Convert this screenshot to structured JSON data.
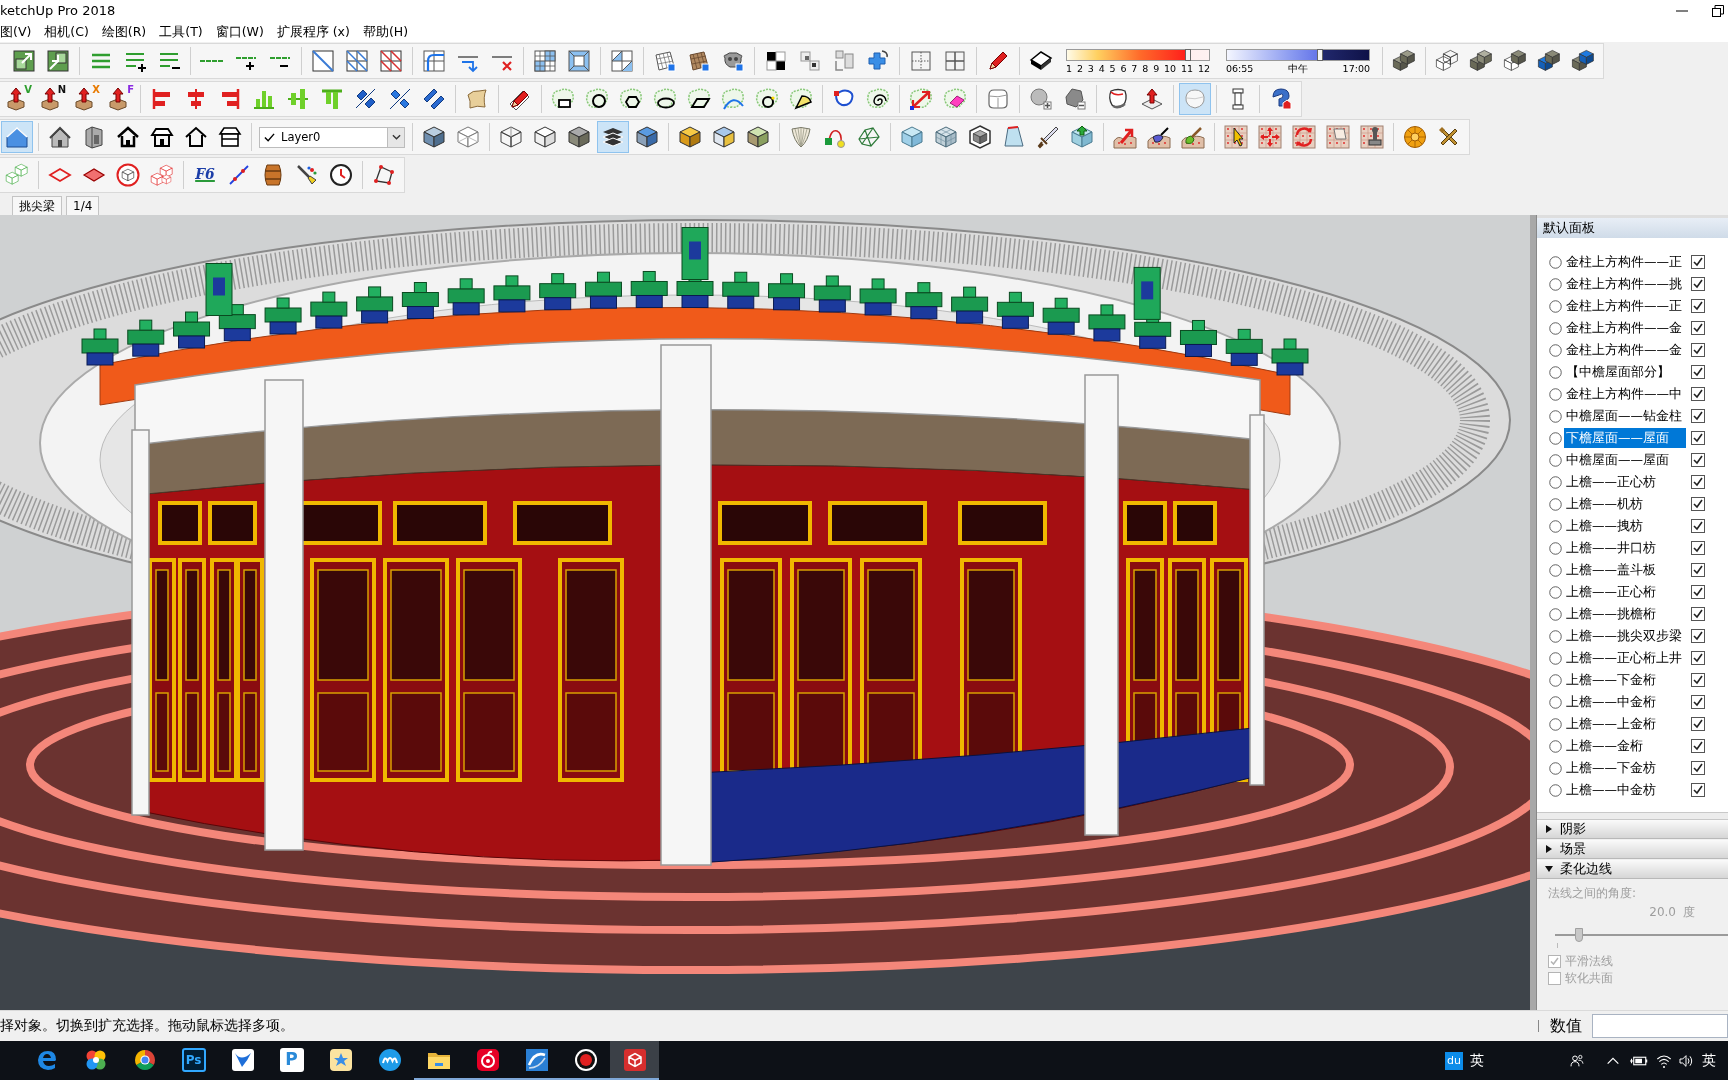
{
  "window": {
    "title": "ketchUp Pro 2018"
  },
  "menu": [
    "图(V)",
    "相机(C)",
    "绘图(R)",
    "工具(T)",
    "窗口(W)",
    "扩展程序 (x)",
    "帮助(H)"
  ],
  "toolbars": [
    [
      [
        {
          "kind": "square-out",
          "selected": false
        },
        {
          "kind": "square-in",
          "selected": false
        }
      ],
      [
        {
          "kind": "lines",
          "selected": false
        },
        {
          "kind": "lines-plus",
          "selected": false
        },
        {
          "kind": "lines-minus",
          "selected": false
        }
      ],
      [
        {
          "kind": "line",
          "selected": false
        },
        {
          "kind": "line-plus",
          "selected": false
        },
        {
          "kind": "line-minus",
          "selected": false
        }
      ],
      [
        {
          "kind": "diag-square",
          "selected": false
        },
        {
          "kind": "diag-grid",
          "selected": false
        },
        {
          "kind": "diag-grid-red",
          "selected": false
        }
      ],
      [
        {
          "kind": "grid-curve",
          "selected": false
        },
        {
          "kind": "line-arrow",
          "selected": false
        },
        {
          "kind": "line-x",
          "selected": false
        }
      ],
      [
        {
          "kind": "grid-blue",
          "selected": false
        },
        {
          "kind": "frame-blue",
          "selected": false
        }
      ],
      [
        {
          "kind": "grid-split",
          "selected": false
        }
      ],
      [
        {
          "kind": "mesh",
          "selected": false
        },
        {
          "kind": "mesh-tex",
          "selected": false
        },
        {
          "kind": "monkey",
          "selected": false
        }
      ],
      [
        {
          "kind": "checker",
          "selected": false
        },
        {
          "kind": "small-squares",
          "selected": false
        },
        {
          "kind": "uv-blocks",
          "selected": false
        },
        {
          "kind": "cross-arrow",
          "selected": false
        }
      ],
      [
        {
          "kind": "pane-dotted",
          "selected": false
        },
        {
          "kind": "pane-grid",
          "selected": false
        }
      ],
      [
        {
          "kind": "pencil",
          "selected": false
        }
      ],
      [
        {
          "kind": "eraser-cube",
          "selected": false
        },
        {
          "kind": "month-slider",
          "level": 0.86,
          "labels": [
            "1",
            "2",
            "3",
            "4",
            "5",
            "6",
            "7",
            "8",
            "9",
            "10",
            "11",
            "12"
          ]
        },
        {
          "kind": "time-slider",
          "level": 0.66,
          "labels": [
            "06:55",
            "中午",
            "17:00"
          ]
        }
      ],
      [
        {
          "kind": "boxes-stack",
          "selected": false
        }
      ],
      [
        {
          "kind": "boxes-wire",
          "selected": false
        },
        {
          "kind": "boxes-grey",
          "selected": false
        },
        {
          "kind": "boxes-mixed",
          "selected": false
        },
        {
          "kind": "boxes-blue",
          "selected": false
        },
        {
          "kind": "boxes-blue2",
          "selected": false
        }
      ]
    ],
    [
      [
        {
          "kind": "arrow-box",
          "label": "V",
          "color": "#2e9e2e",
          "selected": false
        },
        {
          "kind": "arrow-box",
          "label": "N",
          "color": "#111111",
          "selected": false
        },
        {
          "kind": "arrow-box",
          "label": "X",
          "color": "#e87a00",
          "selected": false
        },
        {
          "kind": "arrow-box",
          "label": "F",
          "color": "#8a2be2",
          "selected": false
        }
      ],
      [
        {
          "kind": "align-left",
          "selected": false
        },
        {
          "kind": "align-center",
          "selected": false
        },
        {
          "kind": "align-right",
          "selected": false
        },
        {
          "kind": "align-bottom",
          "selected": false
        },
        {
          "kind": "align-middle",
          "selected": false
        },
        {
          "kind": "align-top",
          "selected": false
        },
        {
          "kind": "distribute-a",
          "selected": false
        },
        {
          "kind": "distribute-b",
          "selected": false
        },
        {
          "kind": "distribute-c",
          "selected": false
        }
      ],
      [
        {
          "kind": "surface",
          "selected": false
        }
      ],
      [
        {
          "kind": "pencil-ruler",
          "selected": false
        }
      ],
      [
        {
          "kind": "cloud-rect",
          "selected": false
        },
        {
          "kind": "cloud-circle",
          "selected": false
        },
        {
          "kind": "cloud-hexagon",
          "selected": false
        },
        {
          "kind": "cloud-ellipse",
          "selected": false
        },
        {
          "kind": "cloud-parallelogram",
          "selected": false
        },
        {
          "kind": "cloud-arc",
          "selected": false
        },
        {
          "kind": "cloud-ring",
          "selected": false
        },
        {
          "kind": "cloud-pie",
          "selected": false
        }
      ],
      [
        {
          "kind": "outline-path",
          "selected": false
        },
        {
          "kind": "cloud-spiral",
          "selected": false
        }
      ],
      [
        {
          "kind": "cloud-arrow",
          "selected": false
        },
        {
          "kind": "cloud-eraser",
          "selected": false
        }
      ],
      [
        {
          "kind": "soft-cube",
          "selected": false
        }
      ],
      [
        {
          "kind": "sphere-plus",
          "selected": false
        },
        {
          "kind": "poly-minus",
          "selected": false
        }
      ],
      [
        {
          "kind": "rock",
          "selected": false
        },
        {
          "kind": "push-up",
          "selected": false
        }
      ],
      [
        {
          "kind": "soft-blob",
          "selected": true
        }
      ],
      [
        {
          "kind": "pillar",
          "selected": false
        }
      ],
      [
        {
          "kind": "hook",
          "selected": false
        }
      ]
    ],
    [
      [
        {
          "kind": "house-blue",
          "selected": true
        }
      ],
      [
        {
          "kind": "house-grey",
          "selected": false
        },
        {
          "kind": "box-door",
          "selected": false
        },
        {
          "kind": "house-black",
          "selected": false
        },
        {
          "kind": "house-roof",
          "selected": false
        },
        {
          "kind": "house-outline",
          "selected": false
        },
        {
          "kind": "house-box",
          "selected": false
        }
      ],
      [
        {
          "kind": "layer-select",
          "value": "Layer0"
        }
      ],
      [
        {
          "kind": "cube-blue",
          "selected": false
        },
        {
          "kind": "cube-wire",
          "selected": false
        }
      ],
      [
        {
          "kind": "box-wire",
          "selected": false
        },
        {
          "kind": "box-white",
          "selected": false
        },
        {
          "kind": "box-grey",
          "selected": false
        },
        {
          "kind": "layers-stack",
          "selected": true
        },
        {
          "kind": "box-blue",
          "selected": false
        }
      ],
      [
        {
          "kind": "cube-yellow",
          "selected": false
        },
        {
          "kind": "cube-tri",
          "selected": false
        },
        {
          "kind": "cube-green",
          "selected": false
        }
      ],
      [
        {
          "kind": "ribbed-shell",
          "selected": false
        },
        {
          "kind": "arc-nodes",
          "selected": false
        },
        {
          "kind": "wire-net",
          "selected": false
        }
      ],
      [
        {
          "kind": "cube-ice",
          "selected": false
        },
        {
          "kind": "cube-mesh",
          "selected": false
        },
        {
          "kind": "cube-outline",
          "selected": false
        },
        {
          "kind": "wedge",
          "selected": false
        },
        {
          "kind": "sword",
          "selected": false
        },
        {
          "kind": "box-arrow",
          "selected": false
        }
      ],
      [
        {
          "kind": "terrain-arrow",
          "selected": false
        },
        {
          "kind": "terrain-stamp",
          "selected": false
        },
        {
          "kind": "terrain-brush",
          "selected": false
        }
      ],
      [
        {
          "kind": "grid-cursor",
          "selected": false
        },
        {
          "kind": "grid-arrows",
          "selected": false
        },
        {
          "kind": "grid-rotate",
          "selected": false
        },
        {
          "kind": "grid-flip",
          "selected": false
        },
        {
          "kind": "grid-stamp",
          "selected": false
        }
      ],
      [
        {
          "kind": "compass",
          "selected": false
        },
        {
          "kind": "tools",
          "selected": false
        }
      ]
    ],
    [
      [
        {
          "kind": "cubes-green",
          "selected": false
        }
      ],
      [
        {
          "kind": "diamond-outline",
          "selected": false
        },
        {
          "kind": "diamond-red",
          "selected": false
        },
        {
          "kind": "cube-ring",
          "selected": false
        },
        {
          "kind": "cubes-red",
          "selected": false
        }
      ],
      [
        {
          "kind": "letter-logo",
          "label": "F6",
          "selected": false
        },
        {
          "kind": "line-dots",
          "selected": false
        },
        {
          "kind": "barrel",
          "selected": false
        },
        {
          "kind": "paint-wand",
          "selected": false
        },
        {
          "kind": "clock",
          "selected": false
        }
      ],
      [
        {
          "kind": "polygon-dots",
          "selected": false
        }
      ]
    ]
  ],
  "scene_tabs": [
    {
      "label": "挑尖梁",
      "selected": false
    },
    {
      "label": "1/4",
      "selected": false
    }
  ],
  "panel": {
    "title": "默认面板",
    "layers": [
      {
        "name": "金柱上方构件——正",
        "active": false,
        "visible": true,
        "selected": false
      },
      {
        "name": "金柱上方构件——挑",
        "active": false,
        "visible": true,
        "selected": false
      },
      {
        "name": "金柱上方构件——正",
        "active": false,
        "visible": true,
        "selected": false
      },
      {
        "name": "金柱上方构件——金",
        "active": false,
        "visible": true,
        "selected": false
      },
      {
        "name": "金柱上方构件——金",
        "active": false,
        "visible": true,
        "selected": false
      },
      {
        "name": "【中檐屋面部分】",
        "active": false,
        "visible": true,
        "selected": false
      },
      {
        "name": "金柱上方构件——中",
        "active": false,
        "visible": true,
        "selected": false
      },
      {
        "name": "中檐屋面——钻金柱",
        "active": false,
        "visible": true,
        "selected": false
      },
      {
        "name": "下檐屋面——屋面",
        "active": false,
        "visible": true,
        "selected": true
      },
      {
        "name": "中檐屋面——屋面",
        "active": false,
        "visible": true,
        "selected": false
      },
      {
        "name": "上檐——正心枋",
        "active": false,
        "visible": true,
        "selected": false
      },
      {
        "name": "上檐——机枋",
        "active": false,
        "visible": true,
        "selected": false
      },
      {
        "name": "上檐——拽枋",
        "active": false,
        "visible": true,
        "selected": false
      },
      {
        "name": "上檐——井口枋",
        "active": false,
        "visible": true,
        "selected": false
      },
      {
        "name": "上檐——盖斗板",
        "active": false,
        "visible": true,
        "selected": false
      },
      {
        "name": "上檐——正心桁",
        "active": false,
        "visible": true,
        "selected": false
      },
      {
        "name": "上檐——挑檐桁",
        "active": false,
        "visible": true,
        "selected": false
      },
      {
        "name": "上檐——挑尖双步梁",
        "active": false,
        "visible": true,
        "selected": false
      },
      {
        "name": "上檐——正心桁上井",
        "active": false,
        "visible": true,
        "selected": false
      },
      {
        "name": "上檐——下金桁",
        "active": false,
        "visible": true,
        "selected": false
      },
      {
        "name": "上檐——中金桁",
        "active": false,
        "visible": true,
        "selected": false
      },
      {
        "name": "上檐——上金桁",
        "active": false,
        "visible": true,
        "selected": false
      },
      {
        "name": "上檐——金桁",
        "active": false,
        "visible": true,
        "selected": false
      },
      {
        "name": "上檐——下金枋",
        "active": false,
        "visible": true,
        "selected": false
      },
      {
        "name": "上檐——中金枋",
        "active": false,
        "visible": true,
        "selected": false
      }
    ],
    "sections": [
      {
        "title": "阴影",
        "expanded": false
      },
      {
        "title": "场景",
        "expanded": false
      },
      {
        "title": "柔化边线",
        "expanded": true,
        "content": {
          "disabled": true,
          "label": "法线之间的角度:",
          "value": "20.0",
          "unit": "度",
          "level": 0.14,
          "options": [
            {
              "label": "平滑法线",
              "checked": true
            },
            {
              "label": "软化共面",
              "checked": false
            }
          ]
        }
      }
    ]
  },
  "status_bar": {
    "message": "择对象。切换到扩充选择。拖动鼠标选择多项。",
    "measurements_label": "数值"
  },
  "taskbar": {
    "apps": [
      {
        "kind": "edge",
        "running": false,
        "selected": false
      },
      {
        "kind": "pinwheel",
        "running": false,
        "selected": false
      },
      {
        "kind": "chrome",
        "running": false,
        "selected": false
      },
      {
        "kind": "photoshop",
        "label": "Ps",
        "running": false,
        "selected": false
      },
      {
        "kind": "bird",
        "running": false,
        "selected": false
      },
      {
        "kind": "p-app",
        "label": "P",
        "running": false,
        "selected": false
      },
      {
        "kind": "k-app",
        "running": false,
        "selected": false
      },
      {
        "kind": "m-app",
        "running": false,
        "selected": false
      },
      {
        "kind": "folder",
        "running": true,
        "selected": false
      },
      {
        "kind": "netease",
        "running": true,
        "selected": false
      },
      {
        "kind": "s-app",
        "running": true,
        "selected": false
      },
      {
        "kind": "record",
        "running": true,
        "selected": false
      },
      {
        "kind": "sketchup",
        "running": true,
        "selected": true
      }
    ],
    "tray": {
      "ime_badge": "du",
      "ime_mode": "英",
      "language": "英"
    }
  }
}
